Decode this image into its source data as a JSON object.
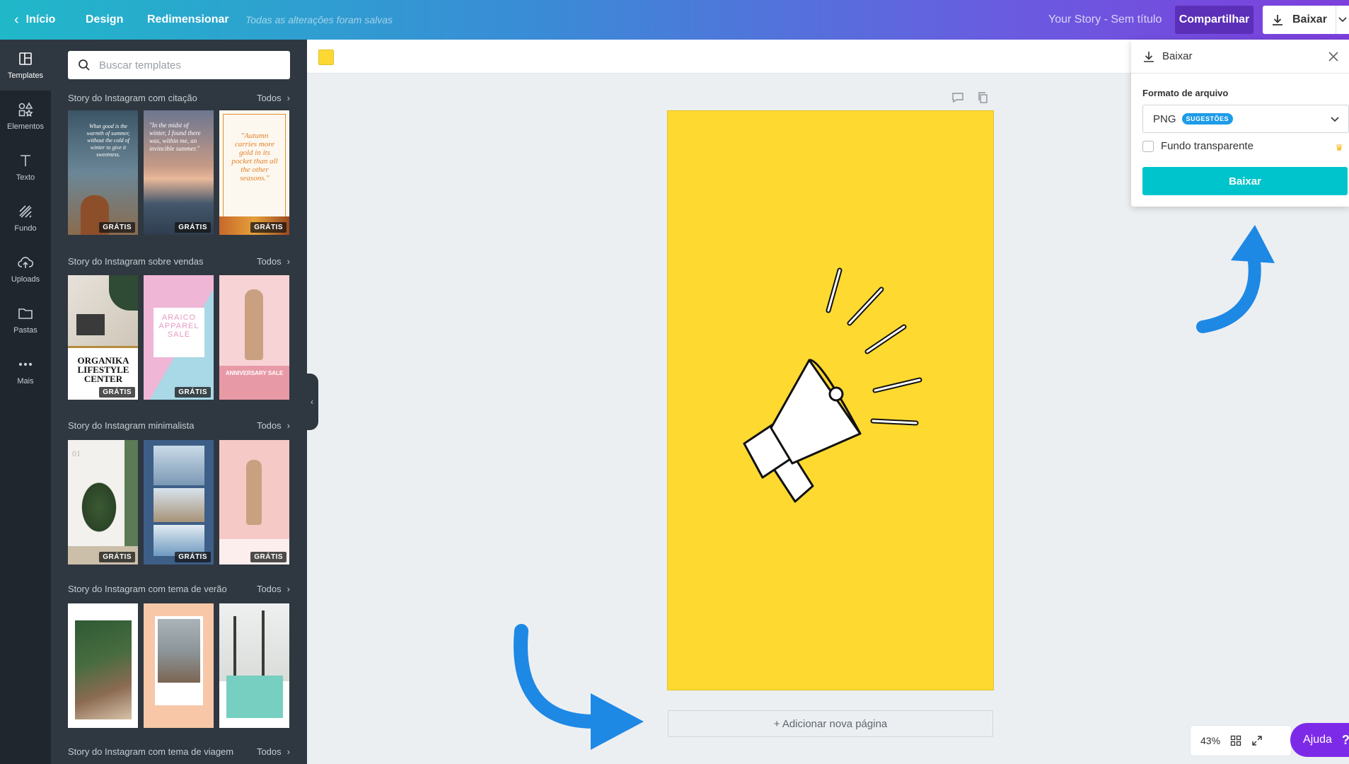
{
  "topbar": {
    "back_label": "Início",
    "design_label": "Design",
    "resize_label": "Redimensionar",
    "save_status": "Todas as alterações foram salvas",
    "doc_title": "Your Story - Sem título",
    "share_label": "Compartilhar",
    "download_label": "Baixar"
  },
  "rail": {
    "items": [
      {
        "label": "Templates",
        "icon": "templates-icon"
      },
      {
        "label": "Elementos",
        "icon": "shapes-icon"
      },
      {
        "label": "Texto",
        "icon": "text-icon"
      },
      {
        "label": "Fundo",
        "icon": "background-icon"
      },
      {
        "label": "Uploads",
        "icon": "upload-cloud-icon"
      },
      {
        "label": "Pastas",
        "icon": "folder-icon"
      },
      {
        "label": "Mais",
        "icon": "more-dots-icon"
      }
    ]
  },
  "panel": {
    "search_placeholder": "Buscar templates",
    "badge": "GRÁTIS",
    "sections": [
      {
        "title": "Story do Instagram com citação",
        "all": "Todos",
        "thumb_texts": [
          "What good is the warmth of summer, without the cold of winter to give it sweetness.",
          "\"In the midst of winter, I found there was, within me, an invincible summer.\"",
          "\"Autumn carries more gold in its pocket than all the other seasons.\""
        ]
      },
      {
        "title": "Story do Instagram sobre vendas",
        "all": "Todos",
        "thumb_texts": [
          "ORGANIKA LIFESTYLE CENTER",
          "ARAICO APPAREL SALE",
          "ANNIVERSARY SALE"
        ]
      },
      {
        "title": "Story do Instagram minimalista",
        "all": "Todos",
        "thumb_texts": [
          "01"
        ]
      },
      {
        "title": "Story do Instagram com tema de verão",
        "all": "Todos"
      },
      {
        "title": "Story do Instagram com tema de viagem",
        "all": "Todos"
      }
    ]
  },
  "canvas": {
    "swatch_color": "#fdd833",
    "page_color": "#fed930",
    "add_page_label": "+ Adicionar nova página"
  },
  "download_popup": {
    "title": "Baixar",
    "format_label": "Formato de arquivo",
    "format_value": "PNG",
    "suggestions_badge": "SUGESTÕES",
    "transparent_label": "Fundo transparente",
    "download_button": "Baixar"
  },
  "bottom": {
    "zoom": "43%",
    "help_label": "Ajuda",
    "help_icon": "?"
  },
  "colors": {
    "accent_teal": "#00c4cc",
    "arrow_blue": "#1e88e5",
    "purple": "#7d2ae8"
  }
}
